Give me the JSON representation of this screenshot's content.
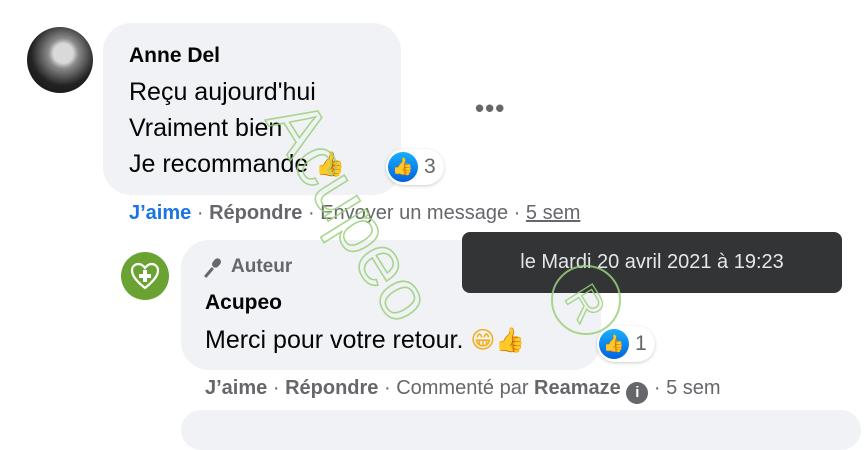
{
  "comment": {
    "author": "Anne Del",
    "lines": [
      "Reçu aujourd'hui",
      "Vraiment bien",
      "Je recommande"
    ],
    "emoji": "👍",
    "reaction_count": "3",
    "more_label": "•••",
    "actions": {
      "like": "J’aime",
      "reply": "Répondre",
      "message": "Envoyer un message",
      "time": "5 sem",
      "sep": "·"
    }
  },
  "reply": {
    "badge": "Auteur",
    "author": "Acupeo",
    "text": "Merci pour votre retour.",
    "emojis": "😁👍",
    "reaction_count": "1",
    "actions": {
      "like": "J’aime",
      "reply": "Répondre",
      "commented_by": "Commenté par",
      "app": "Reamaze",
      "info": "i",
      "time": "5 sem",
      "sep": "·"
    }
  },
  "tooltip": {
    "text": "le Mardi 20 avril 2021 à 19:23"
  },
  "watermark": {
    "text": "Acupeo"
  },
  "colors": {
    "bubble": "#f0f2f5",
    "link_blue": "#1b74e4",
    "muted": "#65676b",
    "tooltip_bg": "#323436",
    "watermark": "#9bd17a",
    "brand_green": "#6aa332"
  }
}
